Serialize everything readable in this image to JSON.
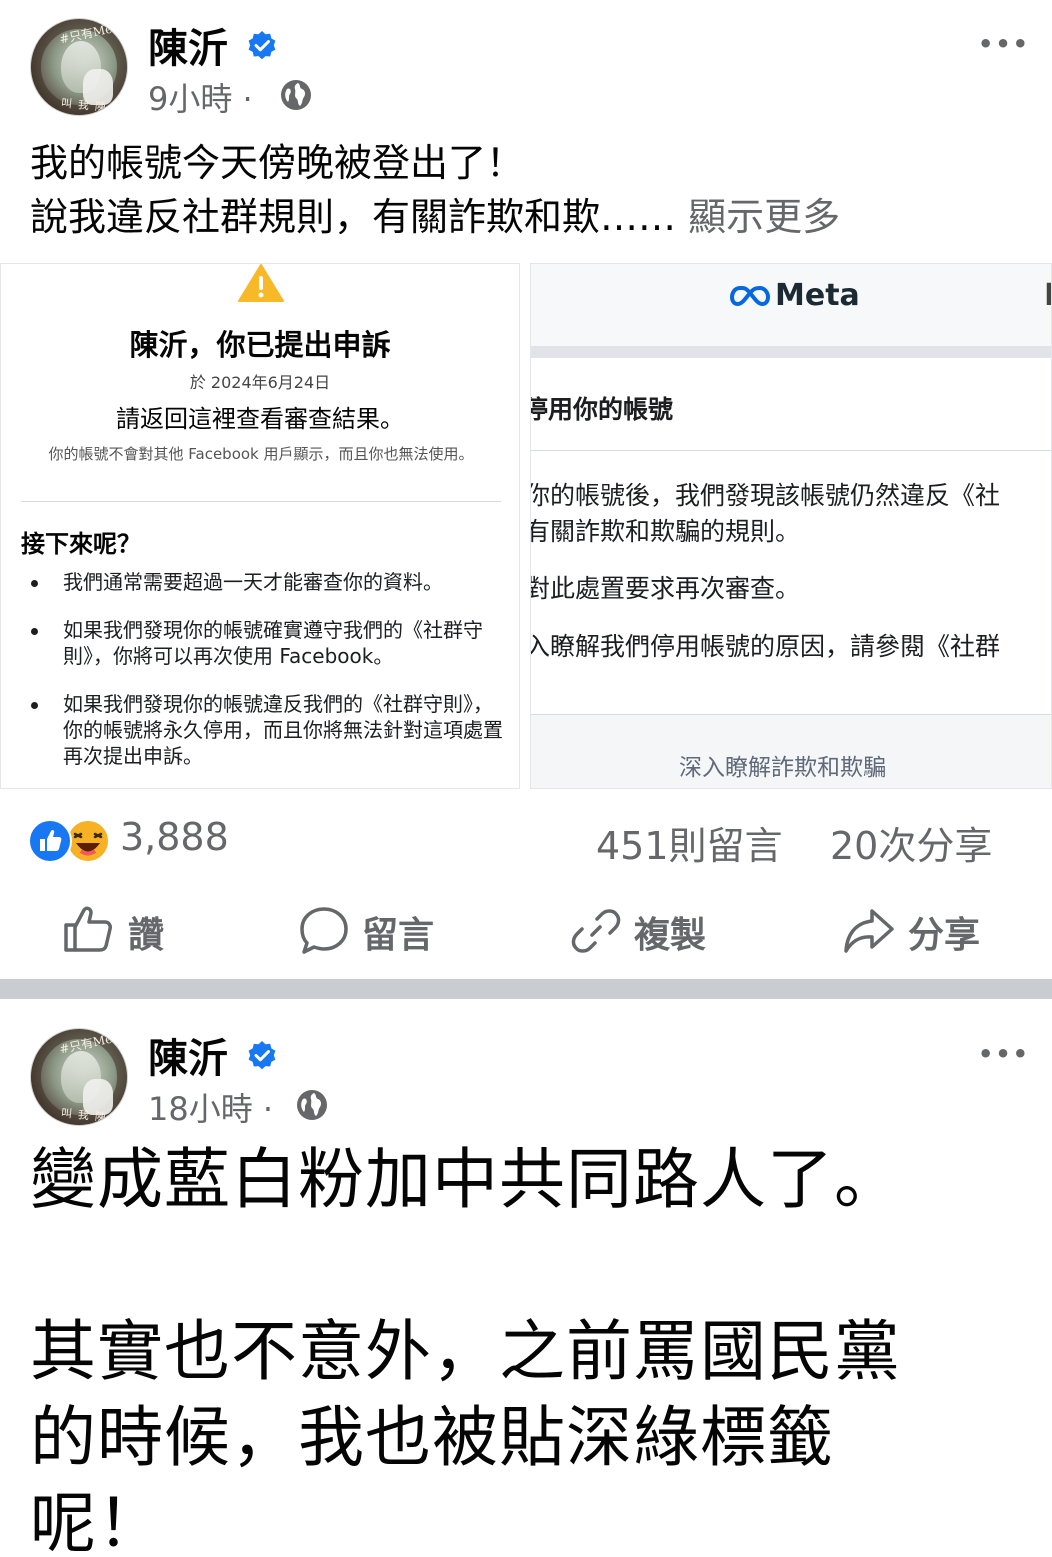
{
  "colors": {
    "accent": "#1877f2",
    "secondary_text": "#65676b",
    "divider": "#c9ccd1"
  },
  "post1": {
    "author": "陳沂",
    "time": "9小時",
    "separator": "·",
    "more": "•••",
    "line1": "我的帳號今天傍晚被登出了！",
    "line2": "說我違反社群規則，有關詐欺和欺……",
    "see_more": "顯示更多",
    "appeal": {
      "title": "陳沂，你已提出申訴",
      "date": "於 2024年6月24日",
      "subtitle": "請返回這裡查看審查結果。",
      "note": "你的帳號不會對其他 Facebook 用戶顯示，而且你也無法使用。",
      "next_heading": "接下來呢？",
      "items": [
        "我們通常需要超過一天才能審查你的資料。",
        "如果我們發現你的帳號確實遵守我們的《社群守則》，你將可以再次使用 Facebook。",
        "如果我們發現你的帳號違反我們的《社群守則》，你的帳號將永久停用，而且你將無法針對這項處置再次提出申訴。"
      ]
    },
    "meta_notice": {
      "logo": "Meta",
      "header_right": "L",
      "heading": "停用你的帳號",
      "text1": "你的帳號後，我們發現該帳號仍然違反《社",
      "text2": "有關詐欺和欺騙的規則。",
      "text3": "對此處置要求再次審查。",
      "text4": "入瞭解我們停用帳號的原因，請參閱《社群",
      "link": "深入瞭解詐欺和欺騙"
    },
    "reactions_count": "3,888",
    "comments": "451則留言",
    "shares": "20次分享",
    "actions": {
      "like": "讚",
      "comment": "留言",
      "copy": "複製",
      "share": "分享"
    }
  },
  "post2": {
    "author": "陳沂",
    "time": "18小時",
    "separator": "·",
    "more": "•••",
    "line1": "變成藍白粉加中共同路人了。",
    "line2": "其實也不意外，之前罵國民黨",
    "line3": "的時候，我也被貼深綠標籤",
    "line4": "呢！"
  },
  "icons": [
    "verified-badge-icon",
    "globe-icon",
    "more-options-icon",
    "like-reaction-icon",
    "haha-reaction-icon",
    "thumbs-up-icon",
    "comment-bubble-icon",
    "link-icon",
    "share-arrow-icon",
    "warning-icon",
    "meta-infinity-icon"
  ]
}
